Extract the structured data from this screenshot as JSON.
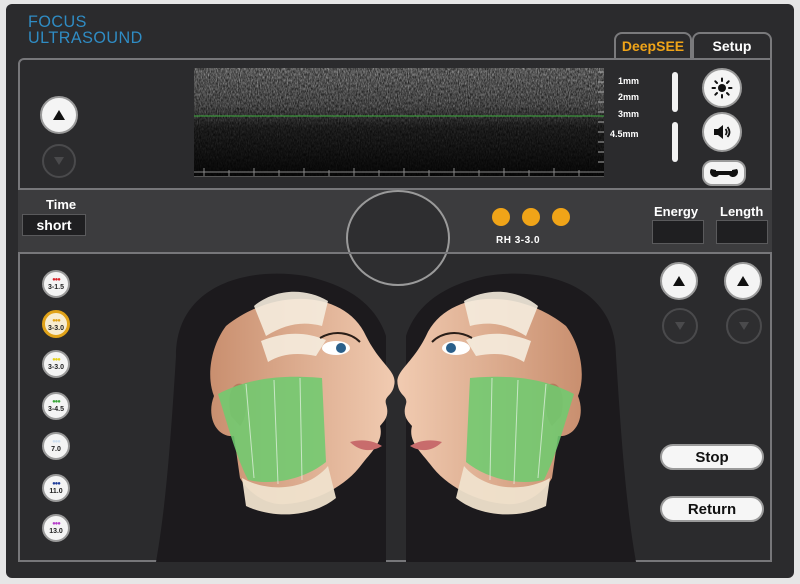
{
  "brand": {
    "line1": "FOCUS",
    "line2": "ULTRASOUND"
  },
  "tabs": [
    {
      "label": "DeepSEE",
      "active": true
    },
    {
      "label": "Setup",
      "active": false
    }
  ],
  "scan": {
    "depths": [
      "1mm",
      "2mm",
      "3mm",
      "4.5mm"
    ]
  },
  "icons": {
    "brightness": "sun-icon",
    "volume": "speaker-icon",
    "settings": "wrench-icon"
  },
  "time": {
    "label": "Time",
    "value": "short"
  },
  "energy": {
    "label": "Energy",
    "value": ""
  },
  "length": {
    "label": "Length",
    "value": ""
  },
  "cartridge_indicator": {
    "text": "RH 3-3.0"
  },
  "cartridges": [
    {
      "label": "3-1.5",
      "color": "#d8232a",
      "selected": false
    },
    {
      "label": "3-3.0",
      "color": "#e0a218",
      "selected": true
    },
    {
      "label": "3-3.0",
      "color": "#e6d21c",
      "selected": false
    },
    {
      "label": "3-4.5",
      "color": "#3aa63a",
      "selected": false
    },
    {
      "label": "7.0",
      "color": "#cfe0f0",
      "selected": false
    },
    {
      "label": "11.0",
      "color": "#1e3c9a",
      "selected": false
    },
    {
      "label": "13.0",
      "color": "#b43cc8",
      "selected": false
    }
  ],
  "buttons": {
    "stop": "Stop",
    "return": "Return"
  },
  "colors": {
    "accent": "#f0a418",
    "brand": "#2f8cc4",
    "background": "#2b2b2d"
  }
}
